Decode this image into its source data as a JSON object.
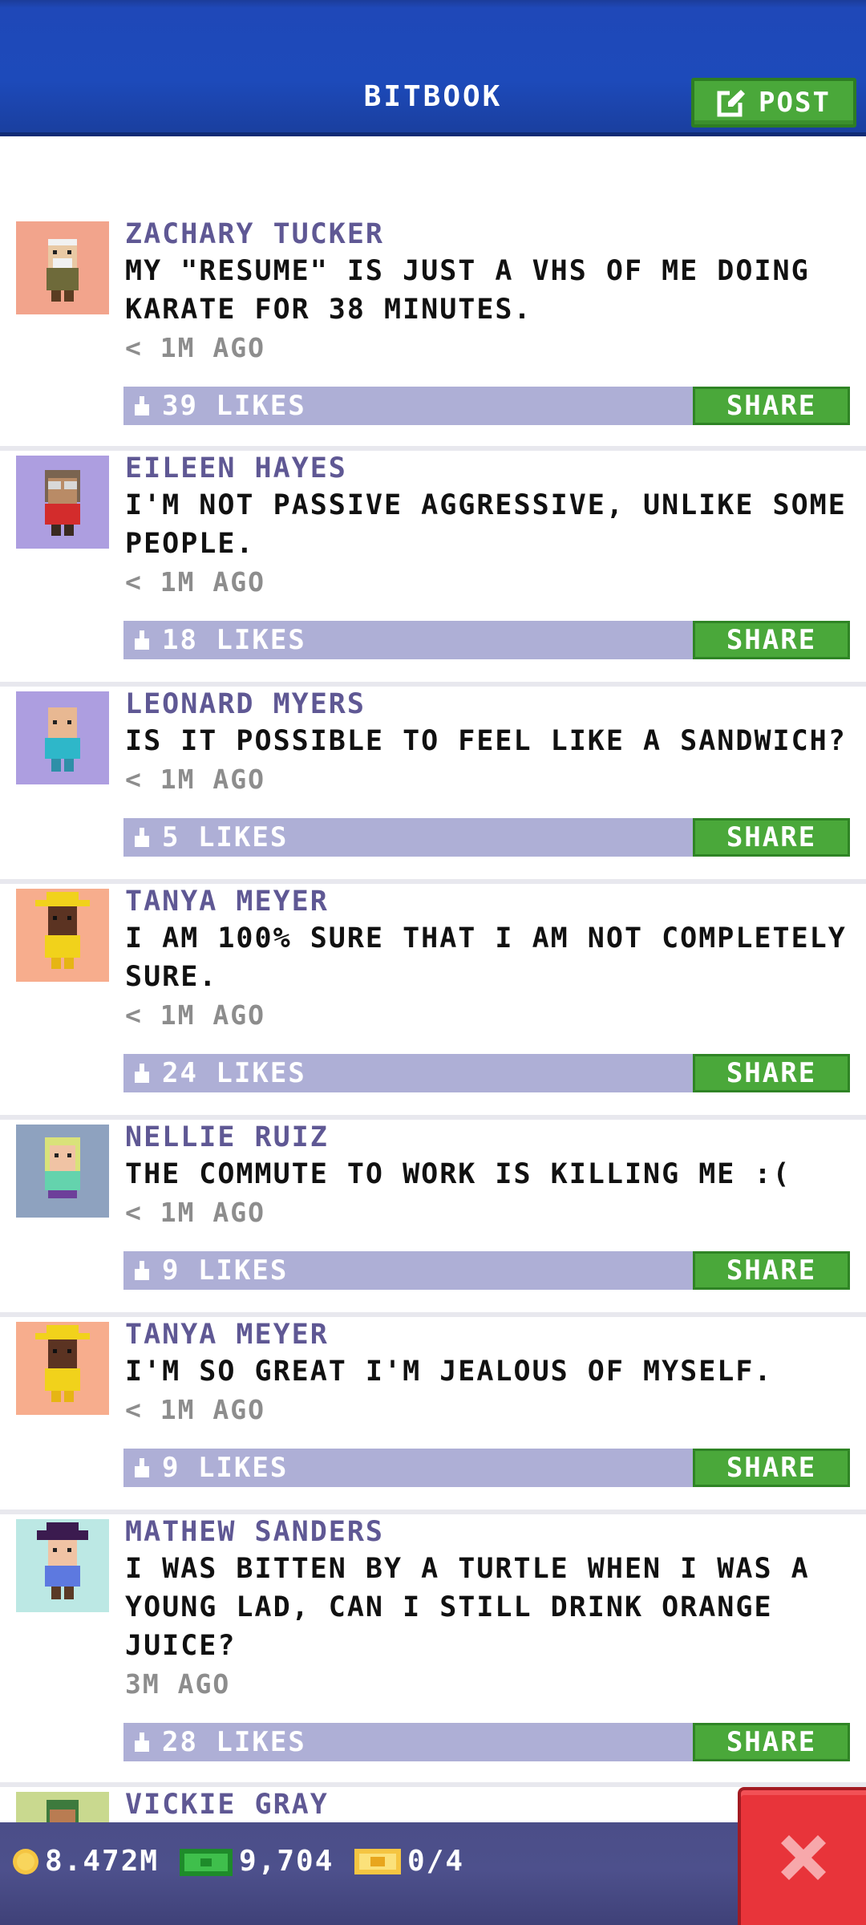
{
  "header": {
    "title": "BITBOOK",
    "post_label": "POST",
    "accent": "#1f48b8"
  },
  "posts": [
    {
      "author": "ZACHARY TUCKER",
      "message": "MY \"RESUME\" IS JUST A VHS OF ME DOING KARATE FOR 38 MINUTES.",
      "time": "< 1M AGO",
      "likes": "39 LIKES",
      "share": "SHARE",
      "avatar_bg": "#f2a48c",
      "avatar_icon": "old-man-avatar-icon"
    },
    {
      "author": "EILEEN HAYES",
      "message": "I'M NOT PASSIVE AGGRESSIVE, UNLIKE SOME PEOPLE.",
      "time": "< 1M AGO",
      "likes": "18 LIKES",
      "share": "SHARE",
      "avatar_bg": "#ad9ee0",
      "avatar_icon": "woman-glasses-avatar-icon"
    },
    {
      "author": "LEONARD MYERS",
      "message": "IS IT POSSIBLE TO FEEL LIKE A SANDWICH?",
      "time": "< 1M AGO",
      "likes": "5 LIKES",
      "share": "SHARE",
      "avatar_bg": "#ad9ee0",
      "avatar_icon": "bald-man-avatar-icon"
    },
    {
      "author": "TANYA MEYER",
      "message": "I AM 100% SURE THAT I AM NOT COMPLETELY SURE.",
      "time": "< 1M AGO",
      "likes": "24 LIKES",
      "share": "SHARE",
      "avatar_bg": "#f7ad8d",
      "avatar_icon": "yellow-hat-avatar-icon"
    },
    {
      "author": "NELLIE RUIZ",
      "message": "THE COMMUTE TO WORK IS KILLING ME :(",
      "time": "< 1M AGO",
      "likes": "9 LIKES",
      "share": "SHARE",
      "avatar_bg": "#8ea2bf",
      "avatar_icon": "blonde-woman-avatar-icon"
    },
    {
      "author": "TANYA MEYER",
      "message": "I'M SO GREAT I'M JEALOUS OF MYSELF.",
      "time": "< 1M AGO",
      "likes": "9 LIKES",
      "share": "SHARE",
      "avatar_bg": "#f7ad8d",
      "avatar_icon": "yellow-hat-avatar-icon"
    },
    {
      "author": "MATHEW SANDERS",
      "message": "I WAS BITTEN BY A TURTLE WHEN I WAS A YOUNG LAD, CAN I STILL DRINK ORANGE JUICE?",
      "time": "3M AGO",
      "likes": "28 LIKES",
      "share": "SHARE",
      "avatar_bg": "#bce8e4",
      "avatar_icon": "pirate-avatar-icon"
    },
    {
      "author": "VICKIE GRAY",
      "message": "",
      "time": "",
      "likes": "",
      "share": "",
      "avatar_bg": "#c9d98f",
      "avatar_icon": "woman-avatar-icon"
    }
  ],
  "bottombar": {
    "coins": "8.472M",
    "bux": "9,704",
    "tickets": "0/4",
    "coin_icon": "coin-icon",
    "bux_icon": "bux-icon",
    "ticket_icon": "ticket-icon",
    "close_icon": "close-icon"
  }
}
